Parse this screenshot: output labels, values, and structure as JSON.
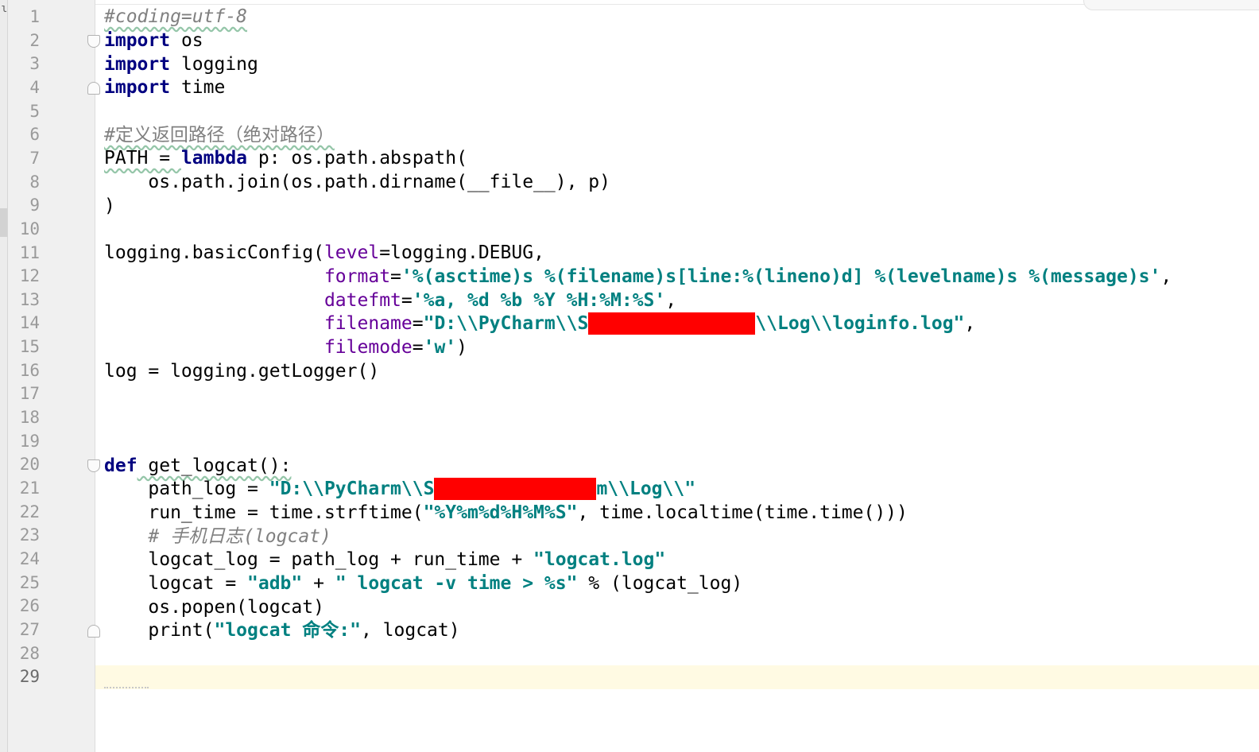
{
  "editor": {
    "line_numbers": [
      "1",
      "2",
      "3",
      "4",
      "5",
      "6",
      "7",
      "8",
      "9",
      "10",
      "11",
      "12",
      "13",
      "14",
      "15",
      "16",
      "17",
      "18",
      "19",
      "20",
      "21",
      "22",
      "23",
      "24",
      "25",
      "26",
      "27",
      "28",
      "29"
    ],
    "current_line": "29",
    "left_strip_glyph": "ɩ"
  },
  "code": {
    "l1": "#coding=utf-8",
    "l2_kw": "import",
    "l2_rest": " os",
    "l3_kw": "import",
    "l3_rest": " logging",
    "l4_kw": "import",
    "l4_rest": " time",
    "l6": "#定义返回路径（绝对路径）",
    "l7_a": "PATH = ",
    "l7_kw": "lambda",
    "l7_b": " p: os.path.abspath(",
    "l8": "    os.path.join(os.path.dirname(__file__), p)",
    "l9": ")",
    "l11_a": "logging.basicConfig(",
    "l11_p": "level",
    "l11_b": "=logging.DEBUG,",
    "l12_indent": "                    ",
    "l12_p": "format",
    "l12_eq": "=",
    "l12_s": "'%(asctime)s %(filename)s[line:%(lineno)d] %(levelname)s %(message)s'",
    "l12_end": ",",
    "l13_indent": "                    ",
    "l13_p": "datefmt",
    "l13_eq": "=",
    "l13_s": "'%a, %d %b %Y %H:%M:%S'",
    "l13_end": ",",
    "l14_indent": "                    ",
    "l14_p": "filename",
    "l14_eq": "=",
    "l14_s1": "\"D:\\\\PyCharm\\\\S",
    "l14_s2": "\\\\Log\\\\loginfo.log\"",
    "l14_end": ",",
    "l15_indent": "                    ",
    "l15_p": "filemode",
    "l15_eq": "=",
    "l15_s": "'w'",
    "l15_end": ")",
    "l16": "log = logging.getLogger()",
    "l20_kw": "def",
    "l20_rest": " get_logcat():",
    "l21_a": "    path_log = ",
    "l21_s1": "\"D:\\\\PyCharm\\\\S",
    "l21_s2": "m\\\\Log\\\\\"",
    "l22_a": "    run_time = time.strftime(",
    "l22_s": "\"%Y%m%d%H%M%S\"",
    "l22_b": ", time.localtime(time.time()))",
    "l23": "    # 手机日志(logcat)",
    "l24_a": "    logcat_log = path_log + run_time + ",
    "l24_s": "\"logcat.log\"",
    "l25_a": "    logcat = ",
    "l25_s1": "\"adb\"",
    "l25_b": " + ",
    "l25_s2": "\" logcat -v time > %s\"",
    "l25_c": " % (logcat_log)",
    "l26": "    os.popen(logcat)",
    "l27_a": "    print(",
    "l27_s": "\"logcat 命令:\"",
    "l27_b": ", logcat)"
  },
  "colors": {
    "keyword": "#000080",
    "string": "#008080",
    "comment": "#808080",
    "param": "#660099",
    "redaction": "#ff0000",
    "current_line_bg": "#fffae3"
  }
}
